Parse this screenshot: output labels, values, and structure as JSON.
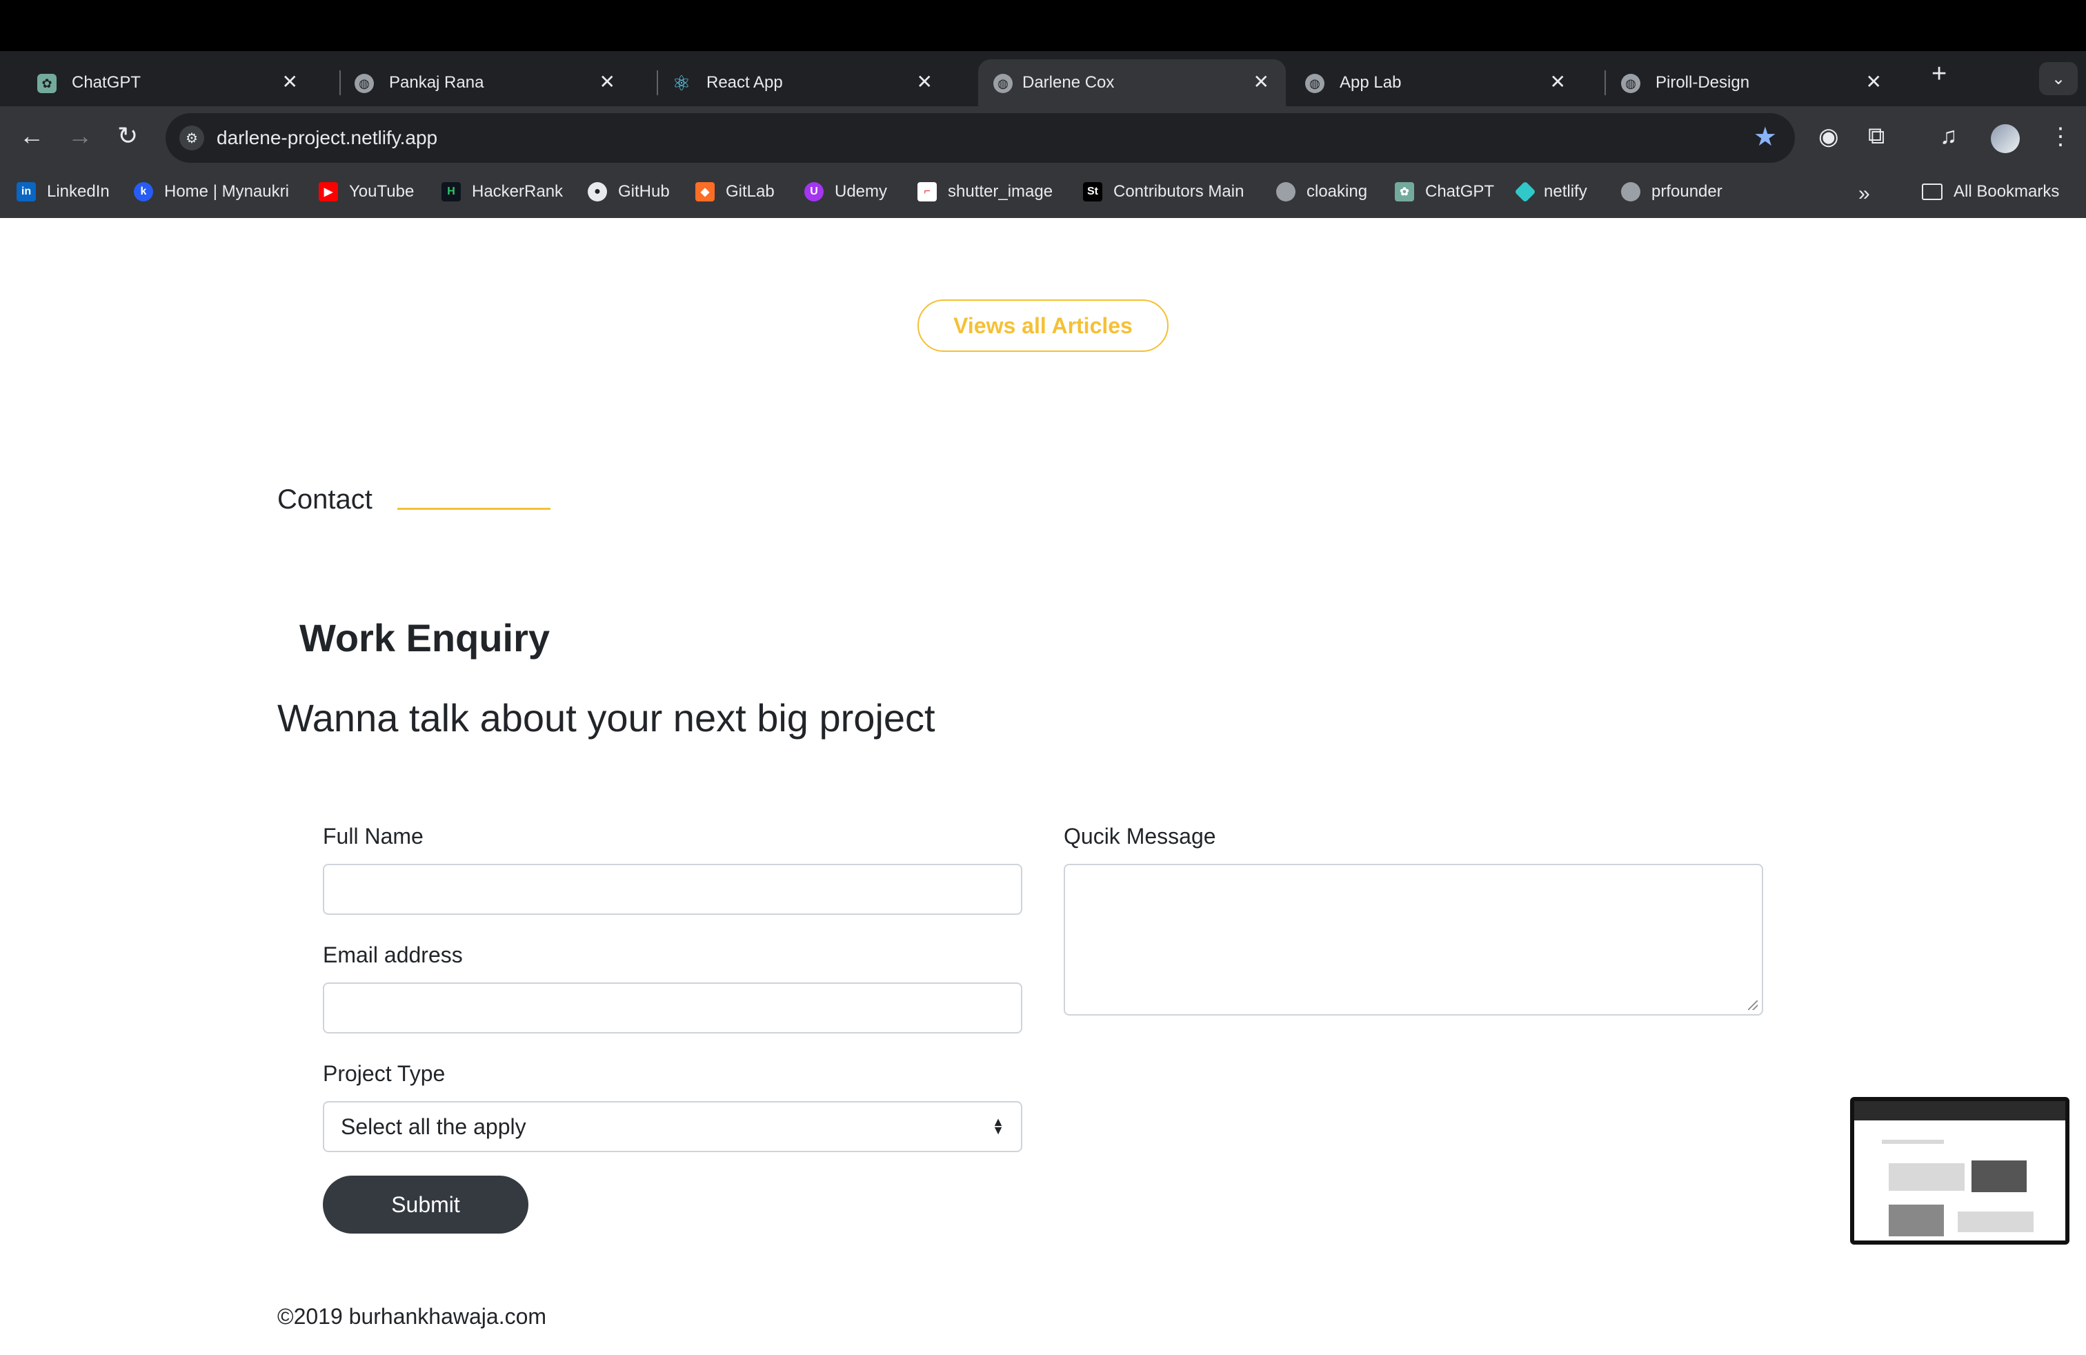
{
  "browser": {
    "tabs": [
      {
        "title": "ChatGPT",
        "icon": "chatgpt-icon",
        "active": false
      },
      {
        "title": "Pankaj Rana",
        "icon": "globe-icon",
        "active": false
      },
      {
        "title": "React App",
        "icon": "react-icon",
        "active": false
      },
      {
        "title": "Darlene Cox",
        "icon": "globe-icon",
        "active": true
      },
      {
        "title": "App Lab",
        "icon": "globe-icon",
        "active": false
      },
      {
        "title": "Piroll-Design",
        "icon": "globe-icon",
        "active": false
      }
    ],
    "url": "darlene-project.netlify.app",
    "bookmarks": [
      {
        "label": "LinkedIn"
      },
      {
        "label": "Home | Mynaukri"
      },
      {
        "label": "YouTube"
      },
      {
        "label": "HackerRank"
      },
      {
        "label": "GitHub"
      },
      {
        "label": "GitLab"
      },
      {
        "label": "Udemy"
      },
      {
        "label": "shutter_image"
      },
      {
        "label": "Contributors Main"
      },
      {
        "label": "cloaking"
      },
      {
        "label": "ChatGPT"
      },
      {
        "label": "netlify"
      },
      {
        "label": "prfounder"
      }
    ],
    "all_bookmarks": "All Bookmarks",
    "overflow": "»"
  },
  "page": {
    "articles_button": "Views all Articles",
    "contact_title": "Contact",
    "enquiry_title": "Work Enquiry",
    "tagline": "Wanna talk about your next big project",
    "form": {
      "full_name_label": "Full Name",
      "full_name_value": "",
      "email_label": "Email address",
      "email_value": "",
      "project_type_label": "Project Type",
      "project_type_selected": "Select all the apply",
      "message_label": "Qucik Message",
      "message_value": "",
      "submit_label": "Submit"
    },
    "footer": "©2019 burhankhawaja.com"
  },
  "colors": {
    "accent": "#f5c035",
    "button_dark": "#343a40",
    "chrome_dark": "#202124",
    "chrome_mid": "#35363a"
  }
}
